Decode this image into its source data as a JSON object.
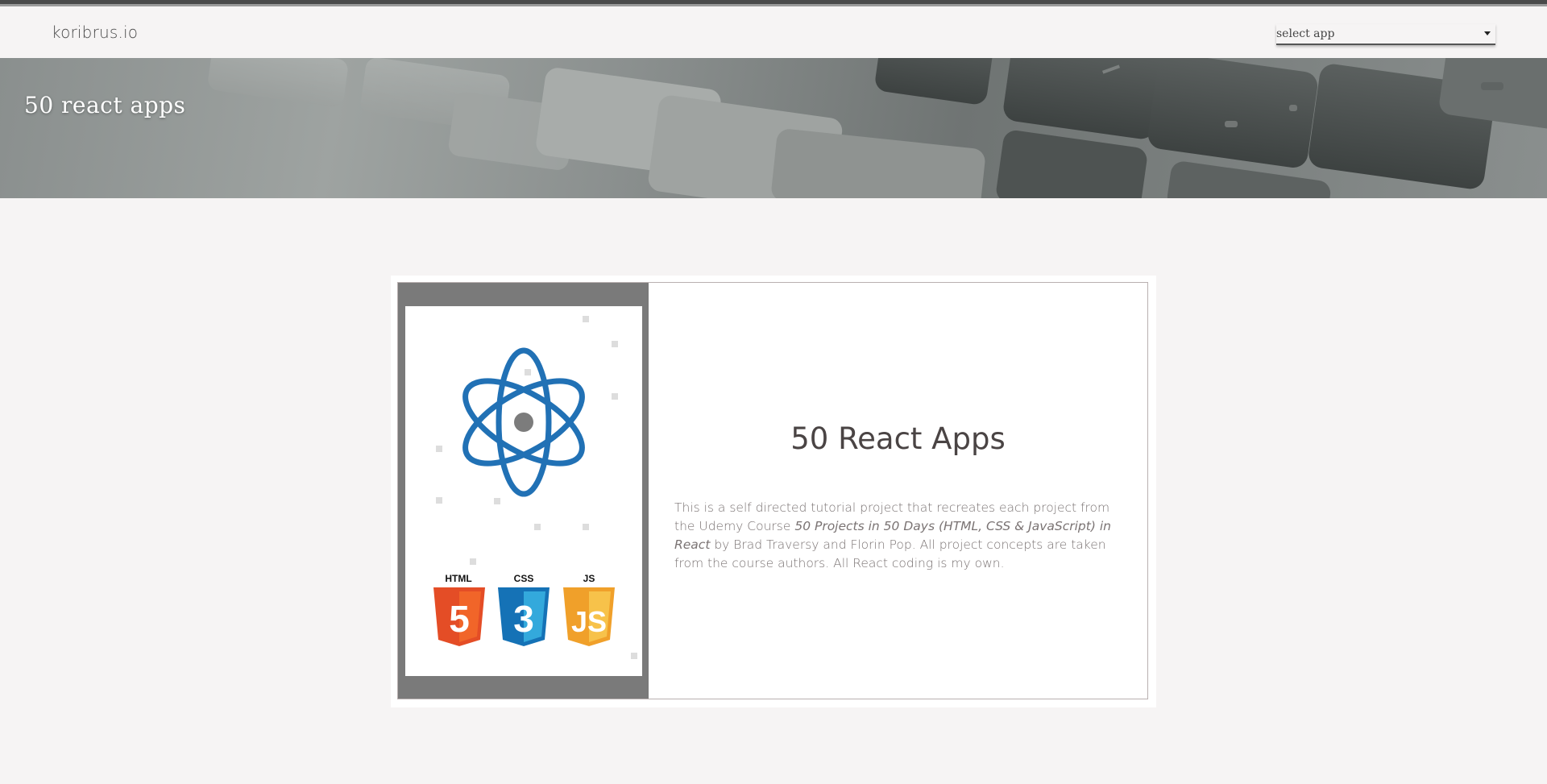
{
  "header": {
    "brand": "koribrus.io",
    "select": {
      "label": "select app"
    }
  },
  "hero": {
    "title": "50 react apps"
  },
  "card": {
    "title": "50 React Apps",
    "description": {
      "part1": "This is a self directed tutorial project that recreates each project from the Udemy Course ",
      "course_title": "50 Projects in 50 Days (HTML, CSS & JavaScript) in React",
      "part2": " by Brad Traversy and Florin Pop. All project concepts are taken from the course authors. All React coding is my own."
    },
    "badges": [
      {
        "label": "HTML",
        "glyph": "5",
        "color": "#e44d26",
        "shade": "#f16529"
      },
      {
        "label": "CSS",
        "glyph": "3",
        "color": "#1572b6",
        "shade": "#33a9dc"
      },
      {
        "label": "JS",
        "glyph": "JS",
        "color": "#f0a02a",
        "shade": "#f7c24a"
      }
    ],
    "react_logo_color": "#2171b5"
  }
}
